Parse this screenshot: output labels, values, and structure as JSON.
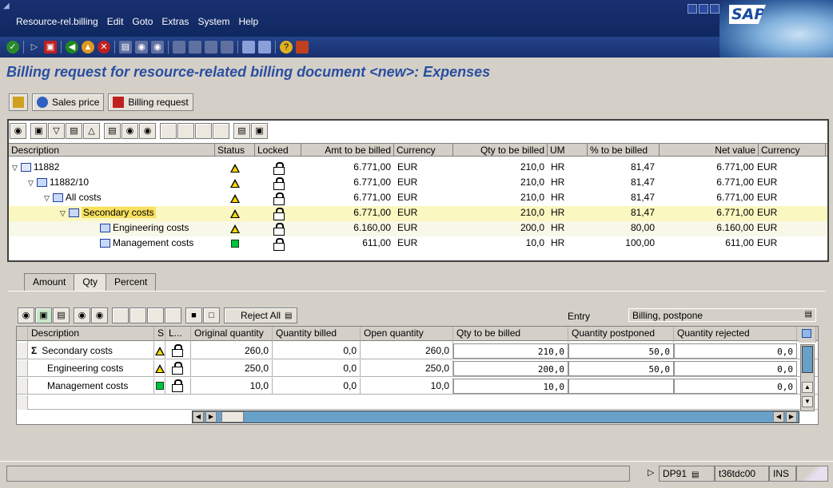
{
  "window": {
    "menu": [
      "Resource-rel.billing",
      "Edit",
      "Goto",
      "Extras",
      "System",
      "Help"
    ],
    "logo": "SAP"
  },
  "page_title": "Billing request for resource-related billing document <new>: Expenses",
  "app_toolbar": {
    "sales_price": "Sales price",
    "billing_request": "Billing request"
  },
  "tree_table": {
    "columns": [
      "Description",
      "Status",
      "Locked",
      "Amt to be billed",
      "Currency",
      "Qty to be billed",
      "UM",
      "% to be billed",
      "Net value",
      "Currency"
    ],
    "rows": [
      {
        "description": "11882",
        "status": "warning",
        "amount": "6.771,00",
        "currency": "EUR",
        "qty": "210,0",
        "um": "HR",
        "pct": "81,47",
        "net": "6.771,00",
        "net_currency": "EUR"
      },
      {
        "description": "11882/10",
        "status": "warning",
        "amount": "6.771,00",
        "currency": "EUR",
        "qty": "210,0",
        "um": "HR",
        "pct": "81,47",
        "net": "6.771,00",
        "net_currency": "EUR"
      },
      {
        "description": "All costs",
        "status": "warning",
        "amount": "6.771,00",
        "currency": "EUR",
        "qty": "210,0",
        "um": "HR",
        "pct": "81,47",
        "net": "6.771,00",
        "net_currency": "EUR"
      },
      {
        "description": "Secondary costs",
        "status": "warning",
        "amount": "6.771,00",
        "currency": "EUR",
        "qty": "210,0",
        "um": "HR",
        "pct": "81,47",
        "net": "6.771,00",
        "net_currency": "EUR"
      },
      {
        "description": "Engineering costs",
        "status": "warning",
        "amount": "6.160,00",
        "currency": "EUR",
        "qty": "200,0",
        "um": "HR",
        "pct": "80,00",
        "net": "6.160,00",
        "net_currency": "EUR"
      },
      {
        "description": "Management costs",
        "status": "ok",
        "amount": "611,00",
        "currency": "EUR",
        "qty": "10,0",
        "um": "HR",
        "pct": "100,00",
        "net": "611,00",
        "net_currency": "EUR"
      }
    ]
  },
  "tabs": [
    "Amount",
    "Qty",
    "Percent"
  ],
  "lower_toolbar": {
    "reject_all": "Reject All",
    "entry_label": "Entry",
    "entry_value": "Billing, postpone"
  },
  "qty_table": {
    "columns": [
      "Description",
      "S",
      "L...",
      "Original quantity",
      "Quantity billed",
      "Open quantity",
      "Qty to be billed",
      "Quantity postponed",
      "Quantity rejected"
    ],
    "rows": [
      {
        "description": "Secondary costs",
        "status": "warning",
        "original": "260,0",
        "billed": "0,0",
        "open": "260,0",
        "to_bill": "210,0",
        "postponed": "50,0",
        "rejected": "0,0"
      },
      {
        "description": "Engineering costs",
        "status": "warning",
        "original": "250,0",
        "billed": "0,0",
        "open": "250,0",
        "to_bill": "200,0",
        "postponed": "50,0",
        "rejected": "0,0"
      },
      {
        "description": "Management costs",
        "status": "ok",
        "original": "10,0",
        "billed": "0,0",
        "open": "10,0",
        "to_bill": "10,0",
        "postponed": "",
        "rejected": "0,0"
      }
    ]
  },
  "status_bar": {
    "system": "DP91",
    "server": "t36tdc00",
    "mode": "INS"
  }
}
